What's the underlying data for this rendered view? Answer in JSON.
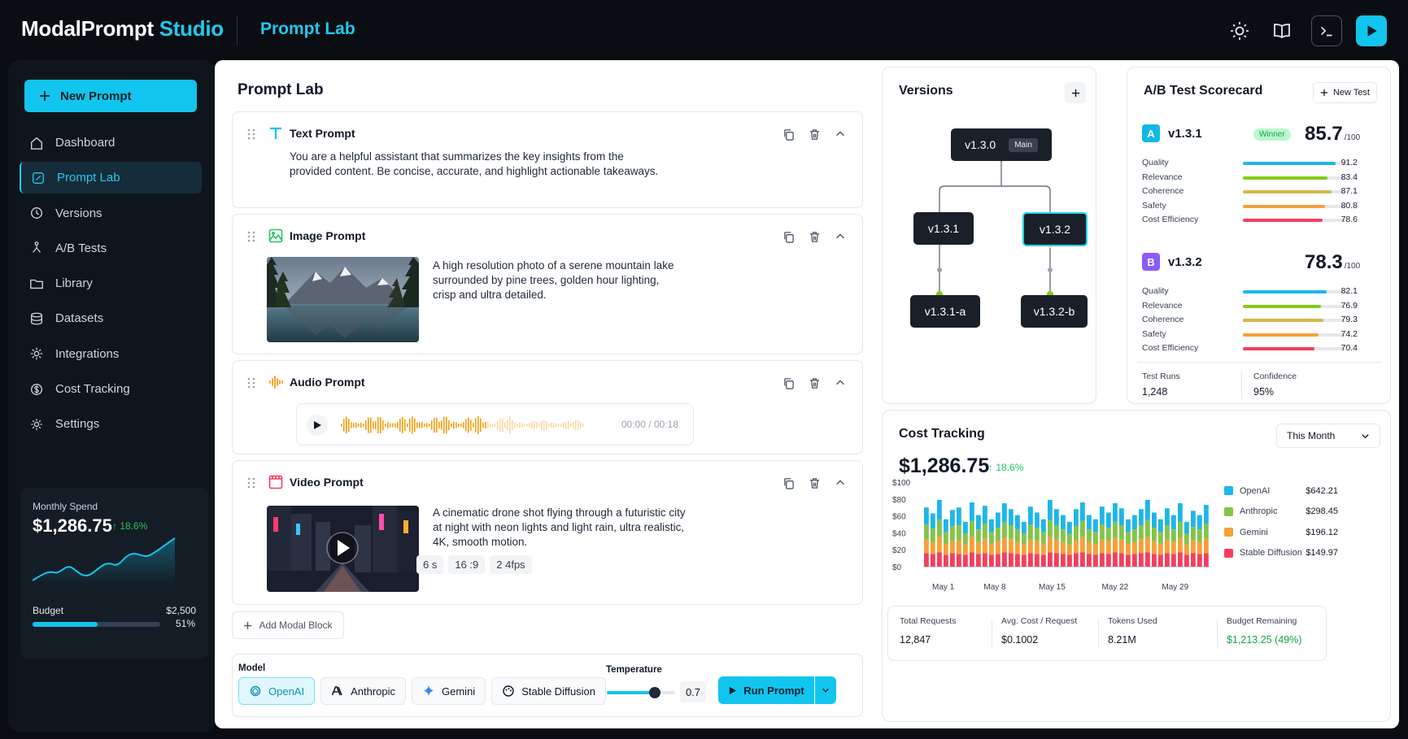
{
  "app": {
    "name_main": "ModalPrompt",
    "name_accent": "Studio",
    "breadcrumb": "Prompt Lab"
  },
  "topbar_icons": [
    "sun-icon",
    "book-icon",
    "terminal-icon",
    "play-icon"
  ],
  "sidebar": {
    "new_prompt": "New Prompt",
    "items": [
      {
        "label": "Dashboard",
        "icon": "home-icon",
        "active": false
      },
      {
        "label": "Prompt Lab",
        "icon": "prompt-lab-icon",
        "active": true
      },
      {
        "label": "Versions",
        "icon": "clock-icon",
        "active": false
      },
      {
        "label": "A/B Tests",
        "icon": "split-icon",
        "active": false
      },
      {
        "label": "Library",
        "icon": "folder-icon",
        "active": false
      },
      {
        "label": "Datasets",
        "icon": "database-icon",
        "active": false
      },
      {
        "label": "Integrations",
        "icon": "puzzle-icon",
        "active": false
      },
      {
        "label": "Cost Tracking",
        "icon": "dollar-icon",
        "active": false
      },
      {
        "label": "Settings",
        "icon": "gear-icon",
        "active": false
      }
    ],
    "spend": {
      "label": "Monthly Spend",
      "amount": "$1,286.75",
      "change": "18.6%",
      "budget_label": "Budget",
      "budget_value": "$2,500",
      "budget_pct": "51%",
      "budget_fraction": 0.51
    }
  },
  "prompt_lab": {
    "title": "Prompt Lab",
    "text_prompt": {
      "title": "Text Prompt",
      "body_line1": "You are a helpful assistant that summarizes the key insights from the",
      "body_line2": "provided content. Be concise, accurate, and highlight actionable takeaways."
    },
    "image_prompt": {
      "title": "Image Prompt",
      "line1": "A high resolution photo of a serene mountain lake",
      "line2": "surrounded by pine trees, golden hour lighting,",
      "line3": "crisp and ultra detailed."
    },
    "audio_prompt": {
      "title": "Audio Prompt",
      "time": "00:00 / 00:18"
    },
    "video_prompt": {
      "title": "Video Prompt",
      "line1": "A cinematic drone shot flying through a futuristic city",
      "line2": "at night with neon lights and light rain, ultra realistic,",
      "line3": "4K, smooth motion.",
      "chips": [
        "6 s",
        "16 :9",
        "2 4fps"
      ]
    },
    "add_block": "Add Modal Block",
    "model": {
      "label": "Model",
      "options": [
        {
          "label": "OpenAI",
          "active": true,
          "icon": "openai-icon"
        },
        {
          "label": "Anthropic",
          "active": false,
          "icon": "anthropic-icon"
        },
        {
          "label": "Gemini",
          "active": false,
          "icon": "gemini-icon"
        },
        {
          "label": "Stable Diffusion",
          "active": false,
          "icon": "palette-icon"
        }
      ],
      "temperature_label": "Temperature",
      "temperature_value": "0.7",
      "temperature_fraction": 0.7,
      "run": "Run Prompt"
    }
  },
  "versions": {
    "title": "Versions",
    "root": "v1.3.0",
    "root_tag": "Main",
    "v1": "v1.3.1",
    "v2": "v1.3.2",
    "v1a": "v1.3.1-a",
    "v2b": "v1.3.2-b"
  },
  "ab_test": {
    "title": "A/B Test Scorecard",
    "new_test": "New Test",
    "a": {
      "badge": "A",
      "version": "v1.3.1",
      "tag": "Winner",
      "score": "85.7",
      "score_max": "/100",
      "metrics": [
        {
          "name": "Quality",
          "value": "91.2",
          "num": 91.2,
          "color": "#1fb6e8"
        },
        {
          "name": "Relevance",
          "value": "83.4",
          "num": 83.4,
          "color": "#84cc16"
        },
        {
          "name": "Coherence",
          "value": "87.1",
          "num": 87.1,
          "color": "#d4b84a"
        },
        {
          "name": "Safety",
          "value": "80.8",
          "num": 80.8,
          "color": "#f5a13a"
        },
        {
          "name": "Cost Efficiency",
          "value": "78.6",
          "num": 78.6,
          "color": "#f43f5e"
        }
      ]
    },
    "b": {
      "badge": "B",
      "version": "v1.3.2",
      "score": "78.3",
      "score_max": "/100",
      "metrics": [
        {
          "name": "Quality",
          "value": "82.1",
          "num": 82.1,
          "color": "#1fb6e8"
        },
        {
          "name": "Relevance",
          "value": "76.9",
          "num": 76.9,
          "color": "#84cc16"
        },
        {
          "name": "Coherence",
          "value": "79.3",
          "num": 79.3,
          "color": "#d4b84a"
        },
        {
          "name": "Safety",
          "value": "74.2",
          "num": 74.2,
          "color": "#f5a13a"
        },
        {
          "name": "Cost Efficiency",
          "value": "70.4",
          "num": 70.4,
          "color": "#f43f5e"
        }
      ]
    },
    "test_runs_label": "Test Runs",
    "test_runs": "1,248",
    "confidence_label": "Confidence",
    "confidence": "95%"
  },
  "cost": {
    "title": "Cost Tracking",
    "period": "This Month",
    "amount": "$1,286.75",
    "change": "18.6%",
    "legend": [
      {
        "name": "OpenAI",
        "value": "$642.21",
        "color": "#1fb6e8"
      },
      {
        "name": "Anthropic",
        "value": "$298.45",
        "color": "#84c44a"
      },
      {
        "name": "Gemini",
        "value": "$196.12",
        "color": "#f5a13a"
      },
      {
        "name": "Stable Diffusion",
        "value": "$149.97",
        "color": "#f43f5e"
      }
    ],
    "stats": [
      {
        "label": "Total Requests",
        "value": "12,847"
      },
      {
        "label": "Avg. Cost / Request",
        "value": "$0.1002"
      },
      {
        "label": "Tokens Used",
        "value": "8.21M"
      },
      {
        "label": "Budget Remaining",
        "value": "$1,213.25 (49%)"
      }
    ]
  },
  "chart_data": {
    "type": "bar",
    "stacked": true,
    "ylim": [
      0,
      100
    ],
    "yticks": [
      "$0",
      "$20",
      "$40",
      "$60",
      "$80",
      "$100"
    ],
    "xticks": [
      "May 1",
      "May 8",
      "May 15",
      "May 22",
      "May 29"
    ],
    "grid": false,
    "series": [
      {
        "name": "Stable Diffusion",
        "values": [
          16,
          15,
          17,
          14,
          16,
          15,
          14,
          17,
          15,
          16,
          14,
          15,
          17,
          16,
          15,
          14,
          16,
          15,
          14,
          17,
          16,
          15,
          14,
          16,
          17,
          15,
          14,
          16,
          15,
          17,
          16,
          14,
          15,
          16,
          17,
          15,
          14,
          16,
          15,
          17,
          14,
          16,
          15,
          16
        ]
      },
      {
        "name": "Gemini",
        "values": [
          16,
          14,
          18,
          13,
          15,
          16,
          12,
          18,
          14,
          17,
          13,
          15,
          17,
          16,
          14,
          12,
          16,
          15,
          13,
          18,
          16,
          14,
          12,
          15,
          18,
          14,
          13,
          16,
          15,
          17,
          16,
          13,
          14,
          16,
          18,
          15,
          13,
          16,
          14,
          17,
          12,
          15,
          14,
          17
        ]
      },
      {
        "name": "Anthropic",
        "values": [
          18,
          16,
          20,
          14,
          17,
          18,
          13,
          19,
          15,
          18,
          14,
          16,
          19,
          17,
          15,
          13,
          18,
          16,
          14,
          20,
          17,
          15,
          13,
          17,
          19,
          15,
          14,
          18,
          16,
          19,
          17,
          14,
          15,
          17,
          20,
          16,
          14,
          17,
          15,
          19,
          13,
          16,
          15,
          18
        ]
      },
      {
        "name": "OpenAI",
        "values": [
          20,
          18,
          24,
          15,
          19,
          21,
          14,
          22,
          17,
          21,
          15,
          18,
          22,
          19,
          17,
          14,
          21,
          18,
          15,
          24,
          19,
          17,
          14,
          20,
          22,
          17,
          15,
          21,
          18,
          22,
          20,
          15,
          17,
          19,
          24,
          18,
          15,
          20,
          17,
          22,
          14,
          19,
          17,
          22
        ]
      }
    ]
  }
}
